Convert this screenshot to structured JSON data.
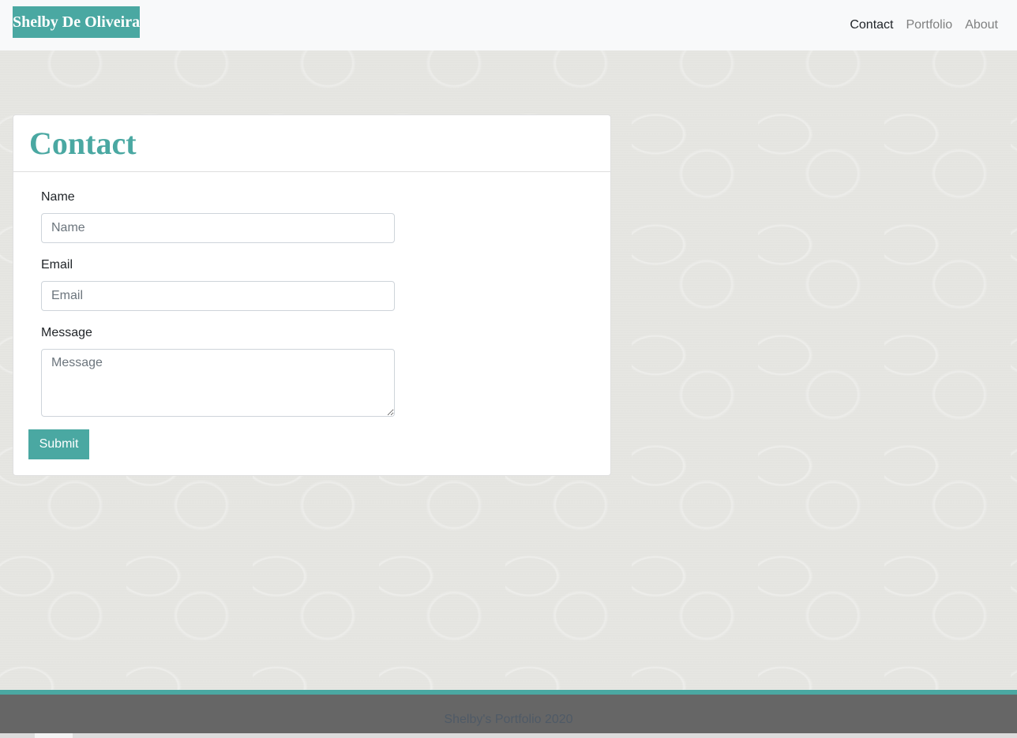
{
  "navbar": {
    "brand": "Shelby De Oliveira",
    "links": [
      {
        "label": "Contact",
        "active": true
      },
      {
        "label": "Portfolio",
        "active": false
      },
      {
        "label": "About",
        "active": false
      }
    ]
  },
  "contact": {
    "title": "Contact",
    "fields": {
      "name_label": "Name",
      "name_placeholder": "Name",
      "email_label": "Email",
      "email_placeholder": "Email",
      "message_label": "Message",
      "message_placeholder": "Message"
    },
    "submit_label": "Submit"
  },
  "footer": {
    "text": "Shelby's Portfolio 2020"
  },
  "colors": {
    "accent": "#4aa8a2",
    "navbar_bg": "#f8f9fa",
    "footer_bg": "#666666"
  }
}
